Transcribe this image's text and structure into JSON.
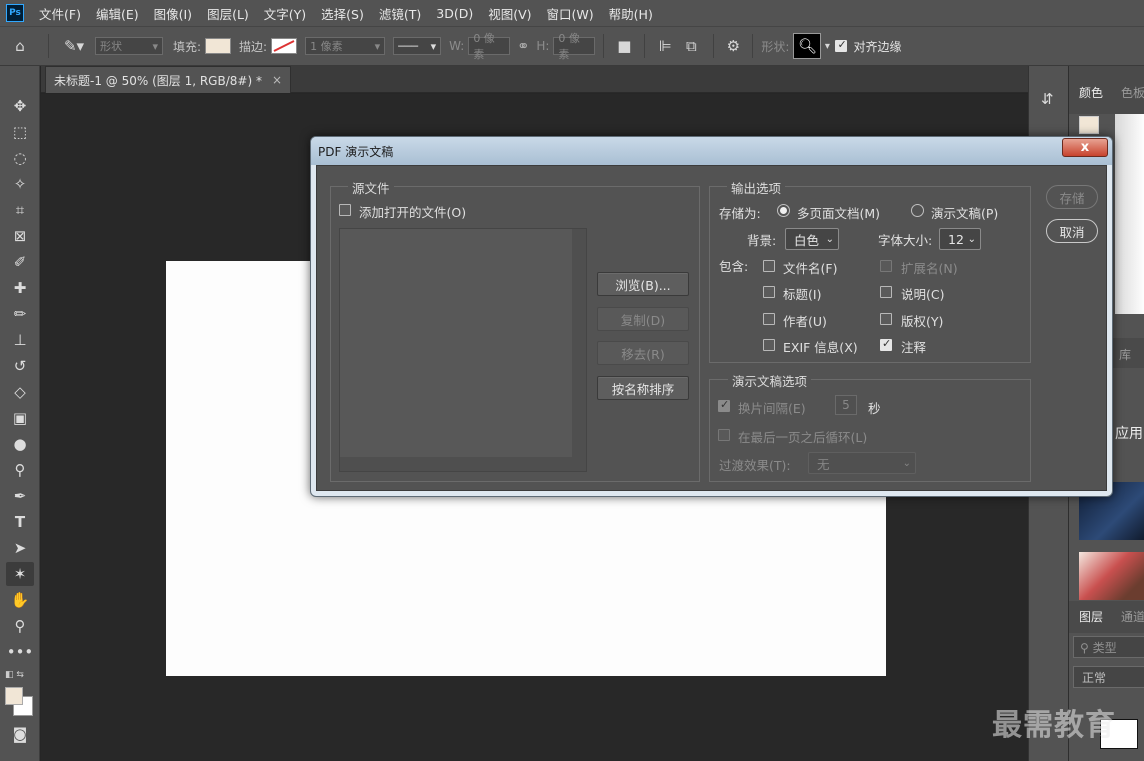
{
  "app": {
    "logo": "Ps",
    "menu": [
      "文件(F)",
      "编辑(E)",
      "图像(I)",
      "图层(L)",
      "文字(Y)",
      "选择(S)",
      "滤镜(T)",
      "3D(D)",
      "视图(V)",
      "窗口(W)",
      "帮助(H)"
    ]
  },
  "options": {
    "mode": "形状",
    "fill_label": "填充:",
    "stroke_label": "描边:",
    "stroke_width": "1 像素",
    "w_label": "W:",
    "w_value": "0 像素",
    "h_label": "H:",
    "h_value": "0 像素",
    "shape_label": "形状:",
    "align_edges": "对齐边缘",
    "fill_color": "#f1e6d6"
  },
  "document": {
    "tab_title": "未标题-1 @ 50% (图层 1, RGB/8#) *",
    "close": "×"
  },
  "right_panels": {
    "tabs_top": [
      "颜色",
      "色板"
    ],
    "tab_library": "库",
    "apply_text": "应用",
    "tabs_layers": [
      "图层",
      "通道"
    ],
    "search_placeholder": "类型",
    "blend_mode": "正常"
  },
  "dialog": {
    "title": "PDF 演示文稿",
    "close": "x",
    "source": {
      "group_title": "源文件",
      "add_open_files": "添加打开的文件(O)",
      "add_open_files_checked": false,
      "browse": "浏览(B)...",
      "duplicate": "复制(D)",
      "remove": "移去(R)",
      "sort_by_name": "按名称排序"
    },
    "output": {
      "group_title": "输出选项",
      "save_as_label": "存储为:",
      "multipage": "多页面文档(M)",
      "presentation": "演示文稿(P)",
      "selected": "multipage",
      "background_label": "背景:",
      "background_value": "白色",
      "font_size_label": "字体大小:",
      "font_size_value": "12",
      "include_label": "包含:",
      "options": [
        {
          "label": "文件名(F)",
          "checked": false,
          "disabled": false
        },
        {
          "label": "扩展名(N)",
          "checked": false,
          "disabled": true
        },
        {
          "label": "标题(I)",
          "checked": false,
          "disabled": false
        },
        {
          "label": "说明(C)",
          "checked": false,
          "disabled": false
        },
        {
          "label": "作者(U)",
          "checked": false,
          "disabled": false
        },
        {
          "label": "版权(Y)",
          "checked": false,
          "disabled": false
        },
        {
          "label": "EXIF 信息(X)",
          "checked": false,
          "disabled": false
        },
        {
          "label": "注释",
          "checked": true,
          "disabled": false
        }
      ]
    },
    "presentation_options": {
      "group_title": "演示文稿选项",
      "advance_every": "换片间隔(E)",
      "advance_checked": true,
      "advance_value": "5",
      "seconds": "秒",
      "loop_after_last": "在最后一页之后循环(L)",
      "loop_checked": false,
      "transition_label": "过渡效果(T):",
      "transition_value": "无"
    },
    "buttons": {
      "save": "存储",
      "cancel": "取消"
    }
  },
  "watermark": "最需教育"
}
